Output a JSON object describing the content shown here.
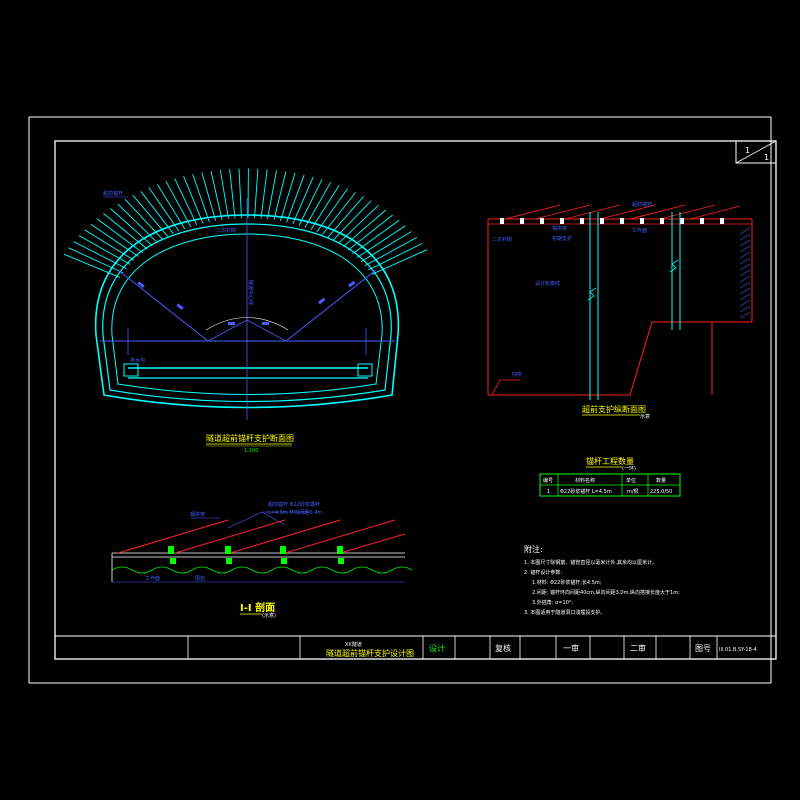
{
  "drawing": {
    "sheet_index": "1",
    "sheet_total": "1",
    "tunnel_section_title": "隧道超前锚杆支护断面图",
    "tunnel_section_scale": "1:100",
    "longitudinal_title": "超前支护纵断面图",
    "longitudinal_scale": "示意",
    "section_title": "I-I 剖面",
    "section_scale": "(示意)",
    "labels": {
      "anchor_rod": "超前锚杆",
      "secondary_lining": "二次衬砌",
      "steel_arch": "钢拱架",
      "primary_support": "初期支护",
      "work_face": "工作面",
      "central_line": "隧道中心线",
      "design_line": "设计轮廓线",
      "excavation_line": "开挖轮廓线",
      "invert": "仰拱",
      "ditch": "排水沟",
      "rod_note_1": "超前锚杆 Φ22砂浆锚杆",
      "rod_note_2": "L=4.5m 环向间距0.4m",
      "arch_label": "钢拱架",
      "rock_label": "围岩"
    },
    "table": {
      "title": "锚杆工程数量",
      "subtitle": "(一环)",
      "headers": [
        "编号",
        "材料名称",
        "单位",
        "数量"
      ],
      "rows": [
        [
          "1",
          "Φ22砂浆锚杆 L=4.5m",
          "m/根",
          "225.0/50"
        ]
      ]
    },
    "notes": {
      "heading": "附注:",
      "items": [
        "1. 本图尺寸除钢筋、锚管直径以毫米计外,其余均以厘米计。",
        "2. 锚杆设计参数:",
        "1.材料: Φ22砂浆锚杆,长4.5m;",
        "2.间距: 锚杆环向间距40cm,纵向间距3.0m,纵向搭接长度大于1m;",
        "3.外插角: α=10°;",
        "3. 本图适用于隧道洞口浅埋段支护。"
      ]
    },
    "title_block": {
      "project": "XX隧道",
      "drawing_name": "隧道超前锚杆支护设计图",
      "design": "设计",
      "review": "复核",
      "check1": "一审",
      "check2": "二审",
      "drawing_no_label": "图号",
      "drawing_no": "III.01.B.SY-18-4"
    },
    "colors": {
      "background": "#000000",
      "border": "#ffffff",
      "cyan": "#00ffff",
      "blue": "#4a5cff",
      "red": "#ff2020",
      "green": "#00ff00",
      "yellow": "#ffff00"
    }
  }
}
